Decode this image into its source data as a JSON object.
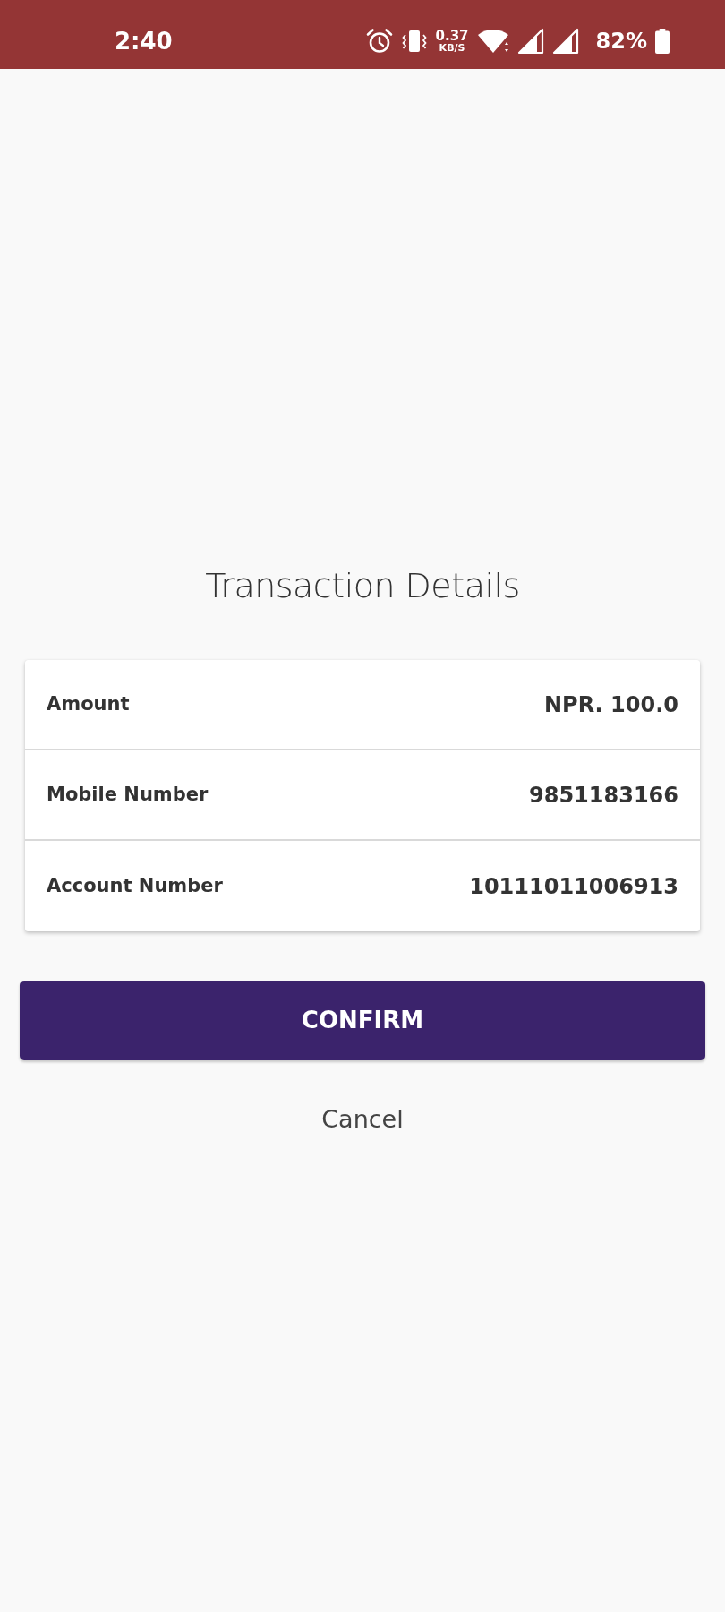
{
  "status_bar": {
    "time": "2:40",
    "network_speed": {
      "value": "0.37",
      "unit": "KB/S"
    },
    "battery": "82%"
  },
  "title": "Transaction Details",
  "details": [
    {
      "label": "Amount",
      "value": "NPR. 100.0"
    },
    {
      "label": "Mobile Number",
      "value": "9851183166"
    },
    {
      "label": "Account Number",
      "value": "10111011006913"
    }
  ],
  "actions": [
    {
      "kind": "primary",
      "label": "CONFIRM"
    },
    {
      "kind": "text",
      "label": "Cancel"
    }
  ]
}
